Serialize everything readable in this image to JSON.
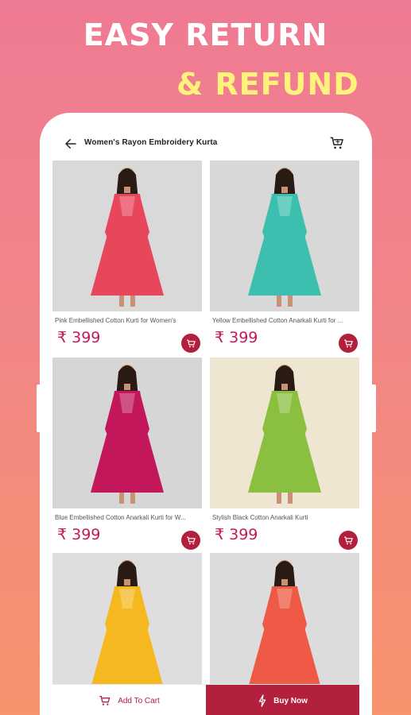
{
  "promo": {
    "line1": "EASY RETURN",
    "line2": "& REFUND"
  },
  "appbar": {
    "title": "Women's Rayon Embroidery Kurta",
    "back_icon": "arrow-left-icon",
    "cart_icon": "cart-icon"
  },
  "products": [
    {
      "name": "Pink Embellished Cotton Kurti for Women's",
      "price": "₹ 399",
      "color": "#e8465a",
      "bg": "#d9d9d9"
    },
    {
      "name": "Yellow Embellished Cotton Anarkali Kurti for ...",
      "price": "₹ 399",
      "color": "#3cbfae",
      "bg": "#d8d8d8"
    },
    {
      "name": "Blue Embellished Cotton Anarkali Kurti for W...",
      "price": "₹ 399",
      "color": "#c2185b",
      "bg": "#d6d6d6"
    },
    {
      "name": "Stylish Black Cotton Anarkali Kurti",
      "price": "₹ 399",
      "color": "#8bbf3f",
      "bg": "#efe6d2"
    },
    {
      "name": "",
      "price": "",
      "color": "#f5b820",
      "bg": "#dedede"
    },
    {
      "name": "",
      "price": "",
      "color": "#ee5a45",
      "bg": "#dcdcdc"
    }
  ],
  "bottom": {
    "add_to_cart": "Add To Cart",
    "buy_now": "Buy Now"
  },
  "colors": {
    "accent": "#b3203e",
    "price": "#c2185b",
    "headline_yellow": "#fff27a"
  }
}
